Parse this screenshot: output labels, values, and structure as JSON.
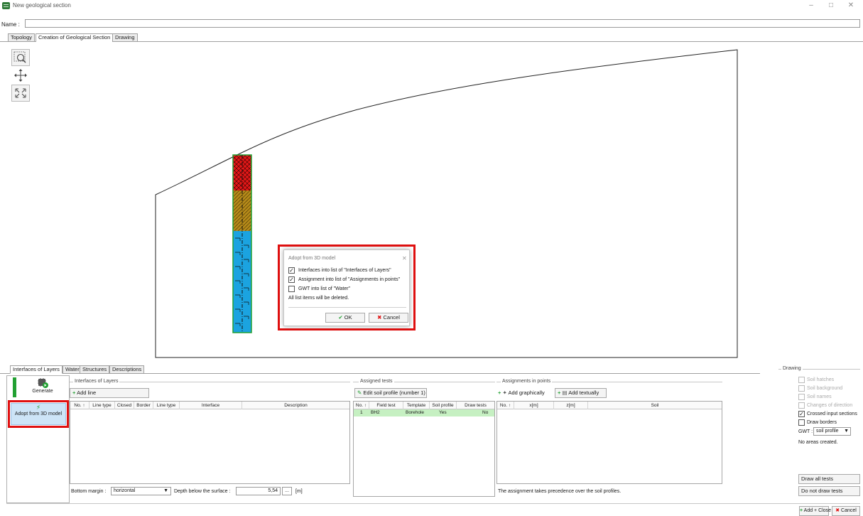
{
  "window": {
    "title": "New geological section",
    "minimize": "–",
    "maximize": "□",
    "close": "✕"
  },
  "name_row": {
    "label": "Name :",
    "value": ""
  },
  "top_tabs": [
    "Topology",
    "Creation of Geological Section",
    "Drawing"
  ],
  "dialog": {
    "title": "Adopt from 3D model",
    "close": "✕",
    "options": [
      {
        "label": "Interfaces into list of \"Interfaces of Layers\"",
        "checked": true
      },
      {
        "label": "Assignment into list of \"Assignments in points\"",
        "checked": true
      },
      {
        "label": "GWT into list of \"Water\"",
        "checked": false
      }
    ],
    "note": "All list items will be deleted.",
    "ok_label": "OK",
    "cancel_label": "Cancel"
  },
  "bottom_tabs": [
    "Interfaces of Layers",
    "Water",
    "Structures",
    "Descriptions"
  ],
  "left_buttons": {
    "generate": "Generate",
    "adopt": "Adopt from 3D model"
  },
  "interfaces": {
    "group_title": "Interfaces of Layers",
    "add_line": "Add line",
    "columns": [
      "No. ↑",
      "Line type",
      "Closed",
      "Border",
      "Line type",
      "Interface",
      "Description"
    ],
    "bottom_margin_label": "Bottom margin :",
    "bottom_margin_value": "horizontal",
    "depth_label": "Depth below the surface :",
    "depth_value": "5,54",
    "depth_unit": "[m]",
    "ellipsis": "..."
  },
  "assigned_tests": {
    "group_title": "Assigned tests",
    "edit_button": "Edit soil profile (number 1)",
    "columns": [
      "No. ↑",
      "Field test",
      "Template",
      "Soil profile",
      "Draw tests"
    ],
    "rows": [
      {
        "no": "1",
        "field_test": "BH2",
        "template": "Borehole",
        "soil_profile": "Yes",
        "draw_tests": "No"
      }
    ]
  },
  "assignments": {
    "group_title": "Assignments in points",
    "add_graphically": "Add graphically",
    "add_textually": "Add textually",
    "columns": [
      "No. ↑",
      "x[m]",
      "z[m]",
      "Soil"
    ],
    "note": "The assignment takes precedence over the soil profiles."
  },
  "drawing": {
    "group_title": "Drawing",
    "options": [
      {
        "label": "Soil hatches",
        "checked": false,
        "enabled": false
      },
      {
        "label": "Soil background",
        "checked": false,
        "enabled": false
      },
      {
        "label": "Soil names",
        "checked": false,
        "enabled": false
      },
      {
        "label": "Changes of direction",
        "checked": false,
        "enabled": false
      },
      {
        "label": "Crossed input sections",
        "checked": true,
        "enabled": true
      },
      {
        "label": "Draw borders",
        "checked": false,
        "enabled": true
      }
    ],
    "gwt_label": "GWT :",
    "gwt_value": "soil profile",
    "no_areas": "No areas created.",
    "draw_all": "Draw all tests",
    "do_not_draw": "Do not draw tests"
  },
  "footer": {
    "add_close": "Add + Close",
    "cancel": "Cancel"
  },
  "colors": {
    "highlight": "#e01010",
    "layer1": "#e41818",
    "layer2": "#b58a1a",
    "layer3": "#1ba3e0",
    "green": "#22a032"
  }
}
